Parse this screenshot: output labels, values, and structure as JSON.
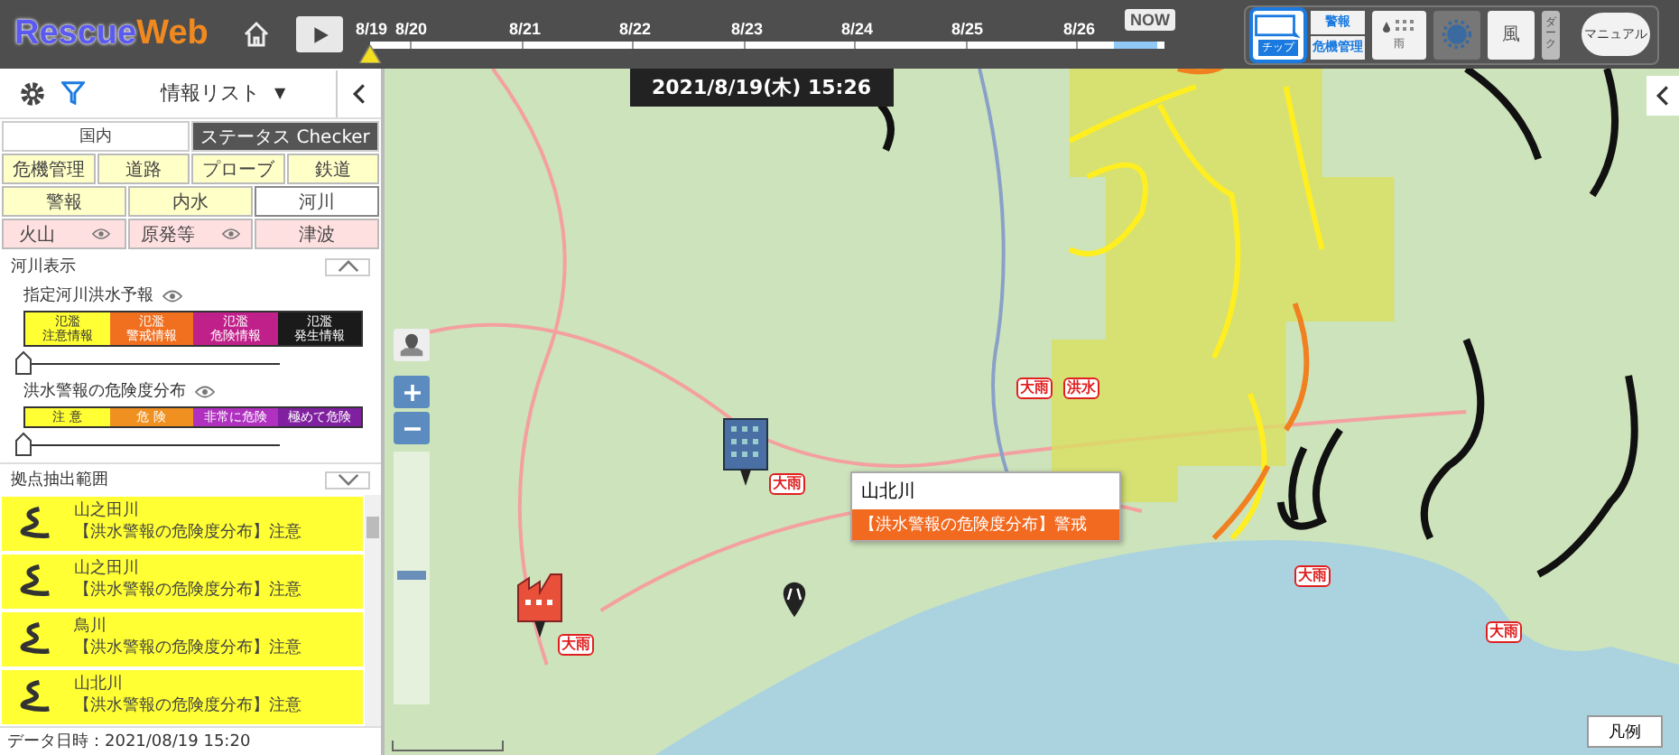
{
  "app": {
    "logo_a": "Rescue",
    "logo_b": "Web"
  },
  "timeline": {
    "dates": [
      "8/19",
      "8/20",
      "8/21",
      "8/22",
      "8/23",
      "8/24",
      "8/25",
      "8/26"
    ],
    "now_label": "NOW",
    "level": 0
  },
  "toolbar": [
    {
      "kind": "chip",
      "label": "チップ",
      "selected": true
    },
    {
      "kind": "pair",
      "label": "警報",
      "label2": "危機管理",
      "selected": false
    },
    {
      "kind": "rain",
      "label": "雨",
      "selected": false
    },
    {
      "kind": "radar",
      "selected": false
    },
    {
      "kind": "text",
      "label": "風",
      "selected": false
    },
    {
      "kind": "tall",
      "label": "ダーク",
      "selected": false
    },
    {
      "kind": "manual",
      "label": "マニュアル",
      "selected": false
    }
  ],
  "panel": {
    "title": "情報リスト",
    "caret": "▼",
    "tabs": [
      {
        "label": "国内",
        "selected": false
      },
      {
        "label": "ステータス Checker",
        "selected": true
      }
    ],
    "category_rows": [
      [
        {
          "label": "危機管理",
          "color": "#ffffc8",
          "eye": false,
          "selected": false
        },
        {
          "label": "道路",
          "color": "#ffffc8",
          "eye": false,
          "selected": false
        },
        {
          "label": "プローブ",
          "color": "#ffffc8",
          "eye": false,
          "selected": false
        },
        {
          "label": "鉄道",
          "color": "#ffffc8",
          "eye": false,
          "selected": false
        }
      ],
      [
        {
          "label": "警報",
          "color": "#ffffc8",
          "eye": false,
          "selected": false
        },
        {
          "label": "内水",
          "color": "#ffffc8",
          "eye": false,
          "selected": false
        },
        {
          "label": "河川",
          "color": "#ffffff",
          "eye": false,
          "selected": true
        }
      ],
      [
        {
          "label": "火山",
          "color": "#ffe0e0",
          "eye": true,
          "selected": false
        },
        {
          "label": "原発等",
          "color": "#ffe0e0",
          "eye": true,
          "selected": false
        },
        {
          "label": "津波",
          "color": "#ffe0e0",
          "eye": false,
          "selected": false
        }
      ]
    ],
    "section_title": "河川表示",
    "layers": [
      {
        "title": "指定河川洪水予報",
        "level": 0,
        "legend": [
          {
            "lines": [
              "氾濫",
              "注意情報"
            ],
            "color": "#ffff33"
          },
          {
            "lines": [
              "氾濫",
              "警戒情報"
            ],
            "color": "#f07020"
          },
          {
            "lines": [
              "氾濫",
              "危険情報"
            ],
            "color": "#c0208a"
          },
          {
            "lines": [
              "氾濫",
              "発生情報"
            ],
            "color": "#1a1a1a"
          }
        ]
      },
      {
        "title": "洪水警報の危険度分布",
        "level": 0,
        "legend": [
          {
            "lines": [
              "注 意"
            ],
            "color": "#ffff33"
          },
          {
            "lines": [
              "危 険"
            ],
            "color": "#f09020"
          },
          {
            "lines": [
              "非常に危険"
            ],
            "color": "#b030c0"
          },
          {
            "lines": [
              "極めて危険"
            ],
            "color": "#8020a0"
          }
        ]
      }
    ],
    "list_title": "拠点抽出範囲",
    "items": [
      {
        "name": "山之田川",
        "detail": "【洪水警報の危険度分布】注意"
      },
      {
        "name": "山之田川",
        "detail": "【洪水警報の危険度分布】注意"
      },
      {
        "name": "鳥川",
        "detail": "【洪水警報の危険度分布】注意"
      },
      {
        "name": "山北川",
        "detail": "【洪水警報の危険度分布】注意"
      }
    ],
    "data_time": "データ日時：2021/08/19 15:20"
  },
  "map": {
    "datetime": "2021/8/19(木)  15:26",
    "badges": [
      "大雨",
      "大雨",
      "洪水",
      "大雨",
      "大雨",
      "大雨"
    ],
    "tooltip": {
      "title": "山北川",
      "detail": "【洪水警報の危険度分布】警戒"
    },
    "legend_button": "凡例",
    "zoom": {
      "level": 0.5
    }
  }
}
